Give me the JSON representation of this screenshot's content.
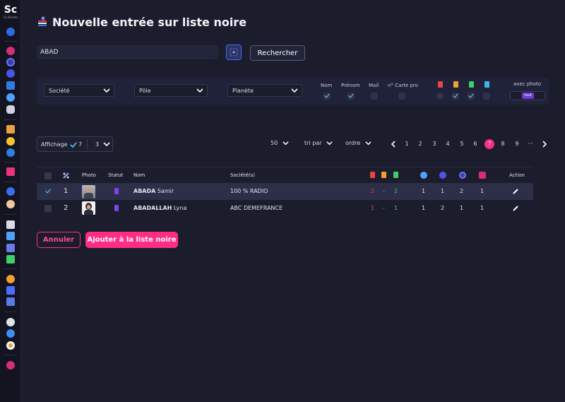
{
  "app": {
    "logo": "Sc",
    "logo_sub": "CL Events"
  },
  "page": {
    "title": "Nouvelle entrée sur liste noire"
  },
  "search": {
    "value": "ABAD",
    "button_label": "Rechercher"
  },
  "filters": {
    "societe_label": "Société",
    "pole_label": "Pôle",
    "planete_label": "Planète",
    "checks": [
      {
        "label": "Nom",
        "checked": true
      },
      {
        "label": "Prénom",
        "checked": true
      },
      {
        "label": "Mail",
        "checked": false
      },
      {
        "label": "n° Carte pro",
        "checked": false
      }
    ],
    "badges": [
      {
        "color": "#e84545",
        "checked": false
      },
      {
        "color": "#f0a030",
        "checked": true
      },
      {
        "color": "#3ccf6a",
        "checked": true
      },
      {
        "color": "#3cb8e6",
        "checked": false
      }
    ],
    "photo_label": "avec photo",
    "photo_value": "tout"
  },
  "toolbar": {
    "affichage_label": "Affichage",
    "affichage_value1": "7",
    "affichage_value2": "3",
    "per_page": "50",
    "sort_label": "tri par",
    "order_label": "ordre",
    "pages": [
      "1",
      "2",
      "3",
      "4",
      "5",
      "6",
      "7",
      "8",
      "9",
      "···"
    ],
    "active_page": "7"
  },
  "table": {
    "headers": {
      "photo": "Photo",
      "statut": "Statut",
      "nom": "Nom",
      "societe": "Société(s)",
      "action": "Action"
    },
    "rows": [
      {
        "index": "1",
        "last": "ABADA",
        "first": "Samir",
        "company": "100 % RADIO",
        "r": "2",
        "dash": "-",
        "g": "2",
        "c1": "1",
        "c2": "1",
        "c3": "2",
        "c4": "1",
        "selected": true
      },
      {
        "index": "2",
        "last": "ABADALLAH",
        "first": "Lyna",
        "company": "ABC DEMEFRANCE",
        "r": "1",
        "dash": "-",
        "g": "1",
        "c1": "1",
        "c2": "2",
        "c3": "1",
        "c4": "1",
        "selected": false
      }
    ]
  },
  "actions": {
    "cancel_label": "Annuler",
    "add_label": "Ajouter à la liste noire"
  },
  "colors": {
    "accent": "#ff2d84",
    "check": "#5fd3ff",
    "purple": "#7b42f0"
  }
}
